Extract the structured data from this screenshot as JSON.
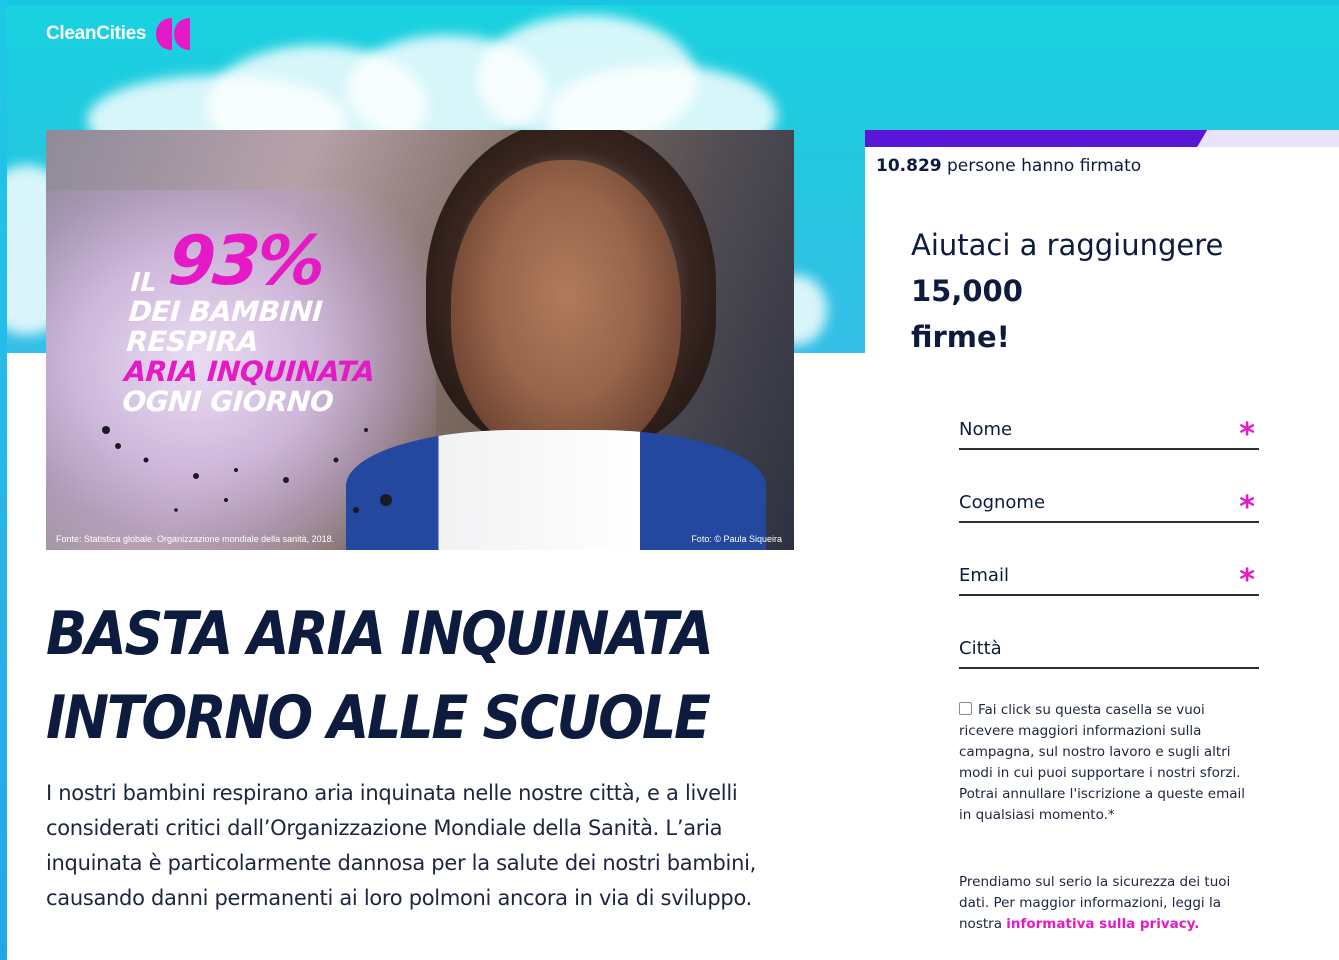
{
  "brand": {
    "name": "CleanCities",
    "accent_color": "#e619c6",
    "navy": "#0d1b3e",
    "sky_color": "#19d2e0",
    "progress_color": "#5a16d6"
  },
  "hero": {
    "stat_prefix": "IL",
    "stat_percent": "93%",
    "stat_line1": "DEI BAMBINI",
    "stat_line2": "RESPIRA",
    "stat_line3": "ARIA INQUINATA",
    "stat_line4": "OGNI GIORNO",
    "source_caption": "Fonte: Statistica globale. Organizzazione mondiale della sanità, 2018.",
    "photo_credit": "Foto: © Paula Siqueira"
  },
  "headline": {
    "line1": "BASTA ARIA INQUINATA",
    "line2": "INTORNO ALLE SCUOLE"
  },
  "body": {
    "paragraph": "I nostri bambini respirano aria inquinata nelle nostre città, e a livelli considerati critici dall’Organizzazione Mondiale della Sanità. L’aria inquinata è particolarmente dannosa per la salute dei nostri bambini, causando danni permanenti ai loro polmoni ancora in via di sviluppo."
  },
  "petition": {
    "progress_fraction": 0.7219,
    "signed_count": "10.829",
    "signed_text": "persone hanno firmato",
    "heading_part1": "Aiutaci a raggiungere",
    "heading_goal": "15,000",
    "heading_part2": "firme!",
    "fields": {
      "first_name": "Nome",
      "last_name": "Cognome",
      "email": "Email",
      "city": "Città",
      "required_mark": "*"
    },
    "consent_text": "Fai click su questa casella se vuoi ricevere maggiori informazioni sulla campagna, sul nostro lavoro e sugli altri modi in cui puoi supportare i nostri sforzi. Potrai annullare l'iscrizione a queste email in qualsiasi momento.*",
    "privacy_text": "Prendiamo sul serio la sicurezza dei tuoi dati. Per maggior informazioni, leggi la nostra",
    "privacy_link": "informativa sulla privacy."
  }
}
